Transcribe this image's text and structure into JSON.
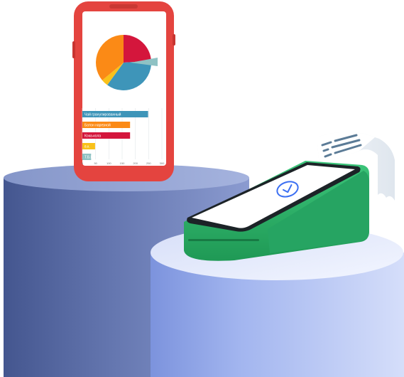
{
  "colors": {
    "pedestal_back": "#6b7db6",
    "pedestal_front": "#a6b8ee",
    "phone_frame": "#e4443f",
    "terminal_body": "#2fb36b",
    "pie_red": "#d4163c",
    "pie_blue": "#3e95b9",
    "pie_orange": "#fb8a16",
    "pie_yellow": "#f9c11a",
    "pie_teal": "#8fc2c4",
    "confirm_blue": "#3b6ff2"
  },
  "icons": {
    "confirm": "check-circle-icon"
  },
  "phone": {
    "bars": [
      {
        "label": "Чай гранулированный",
        "value": 248,
        "color": "#3e95b9"
      },
      {
        "label": "Батон нарезной",
        "value": 180,
        "color": "#fb8a16"
      },
      {
        "label": "Кока-кола",
        "value": 180,
        "color": "#d4163c"
      },
      {
        "label": "в.к.",
        "value": 48,
        "color": "#f9c11a"
      },
      {
        "label": "Т.Б.И",
        "value": 33,
        "color": "#8fc2c4"
      }
    ],
    "ticks": [
      "0",
      "50",
      "100",
      "150",
      "200",
      "250",
      "300"
    ],
    "axis_max": 300,
    "pie": [
      {
        "name": "red",
        "value": 24,
        "color": "#d4163c"
      },
      {
        "name": "blue",
        "value": 36,
        "color": "#3e95b9"
      },
      {
        "name": "yellow",
        "value": 4,
        "color": "#f9c11a"
      },
      {
        "name": "orange",
        "value": 36,
        "color": "#fb8a16"
      }
    ],
    "pie_exploded": {
      "name": "teal",
      "color": "#8fc2c4"
    }
  }
}
